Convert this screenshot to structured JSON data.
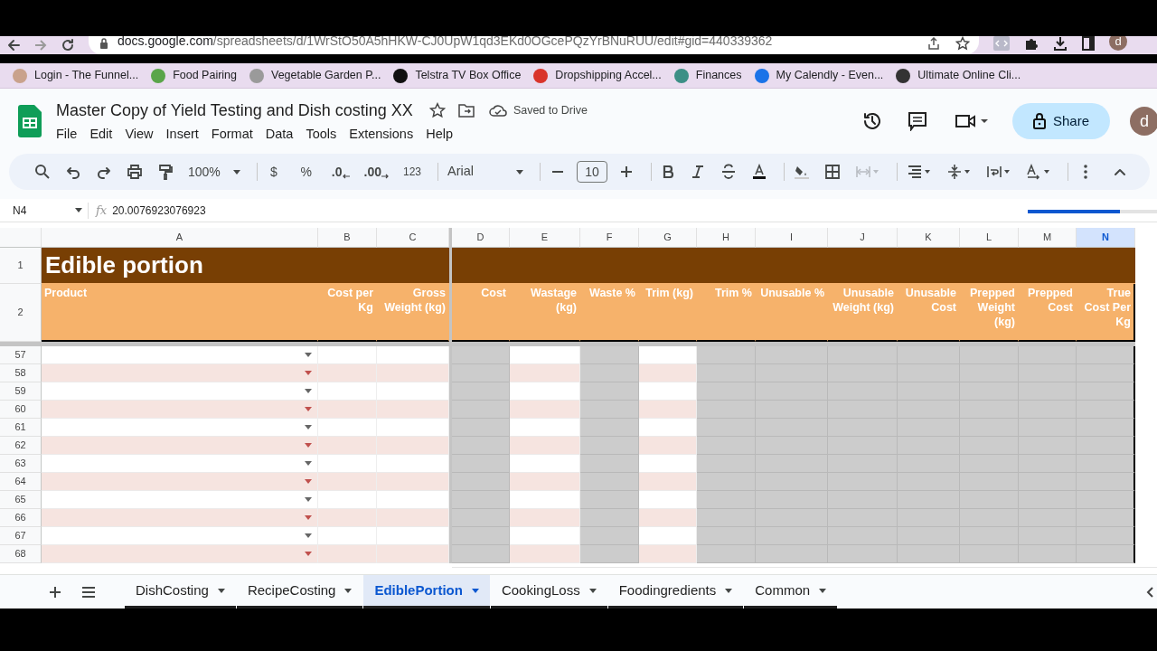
{
  "browser": {
    "address_host": "docs.google.com",
    "address_path": "/spreadsheets/d/1WrStO50A5hHKW-CJ0UpW1qd3EKd0OGcePQzYrBNuRUU/edit#gid=440339362",
    "profile": "d",
    "bookmarks": [
      {
        "label": "Login - The Funnel...",
        "color": "#c9a28c"
      },
      {
        "label": "Food Pairing",
        "color": "#5aa54a"
      },
      {
        "label": "Vegetable Garden P...",
        "color": "#9a9a9a"
      },
      {
        "label": "Telstra TV Box Office",
        "color": "#111111"
      },
      {
        "label": "Dropshipping Accel...",
        "color": "#d9342b"
      },
      {
        "label": "Finances",
        "color": "#3c8f86"
      },
      {
        "label": "My Calendly - Even...",
        "color": "#1a73e8"
      },
      {
        "label": "Ultimate Online Cli...",
        "color": "#333333"
      }
    ]
  },
  "doc": {
    "title": "Master Copy of Yield Testing and Dish costing XX",
    "save_status": "Saved to Drive",
    "share": "Share",
    "avatar": "d",
    "menus": [
      "File",
      "Edit",
      "View",
      "Insert",
      "Format",
      "Data",
      "Tools",
      "Extensions",
      "Help"
    ]
  },
  "toolbar": {
    "zoom": "100%",
    "currency": "$",
    "percent": "%",
    "decrease_decimals": ".0",
    "increase_decimals": ".00",
    "more_formats": "123",
    "font": "Arial",
    "font_size": "10"
  },
  "formula_bar": {
    "cell_ref": "N4",
    "fx": "fx",
    "value": "20.0076923076923",
    "loading": {
      "level": 0.71
    }
  },
  "sheet": {
    "title": "Edible portion",
    "columns": [
      {
        "letter": "A",
        "heading": "Product",
        "kind": "dropdown",
        "selected": false
      },
      {
        "letter": "B",
        "heading": "Cost per Kg",
        "kind": "input",
        "selected": false
      },
      {
        "letter": "C",
        "heading": "Gross Weight (kg)",
        "kind": "input",
        "selected": false
      },
      {
        "letter": "D",
        "heading": "Cost",
        "kind": "calculated",
        "selected": false
      },
      {
        "letter": "E",
        "heading": "Wastage (kg)",
        "kind": "input",
        "selected": false
      },
      {
        "letter": "F",
        "heading": "Waste %",
        "kind": "calculated",
        "selected": false
      },
      {
        "letter": "G",
        "heading": "Trim (kg)",
        "kind": "input",
        "selected": false
      },
      {
        "letter": "H",
        "heading": "Trim %",
        "kind": "calculated",
        "selected": false
      },
      {
        "letter": "I",
        "heading": "Unusable %",
        "kind": "calculated",
        "selected": false
      },
      {
        "letter": "J",
        "heading": "Unusable Weight (kg)",
        "kind": "calculated",
        "selected": false
      },
      {
        "letter": "K",
        "heading": "Unusable Cost",
        "kind": "calculated",
        "selected": false
      },
      {
        "letter": "L",
        "heading": "Prepped Weight (kg)",
        "kind": "calculated",
        "selected": false
      },
      {
        "letter": "M",
        "heading": "Prepped Cost",
        "kind": "calculated",
        "selected": false
      },
      {
        "letter": "N",
        "heading": "True Cost Per Kg",
        "kind": "calculated",
        "selected": true
      }
    ],
    "header_rows": [
      "1",
      "2"
    ],
    "rows": [
      {
        "number": "57",
        "banded": false
      },
      {
        "number": "58",
        "banded": true
      },
      {
        "number": "59",
        "banded": false
      },
      {
        "number": "60",
        "banded": true
      },
      {
        "number": "61",
        "banded": false
      },
      {
        "number": "62",
        "banded": true
      },
      {
        "number": "63",
        "banded": false
      },
      {
        "number": "64",
        "banded": true
      },
      {
        "number": "65",
        "banded": false
      },
      {
        "number": "66",
        "banded": true
      },
      {
        "number": "67",
        "banded": false
      },
      {
        "number": "68",
        "banded": true
      }
    ]
  },
  "sheet_tabs": [
    {
      "label": "DishCosting",
      "selected": false
    },
    {
      "label": "RecipeCosting",
      "selected": false
    },
    {
      "label": "EdiblePortion",
      "selected": true
    },
    {
      "label": "CookingLoss",
      "selected": false
    },
    {
      "label": "Foodingredients",
      "selected": false
    },
    {
      "label": "Common",
      "selected": false
    }
  ]
}
